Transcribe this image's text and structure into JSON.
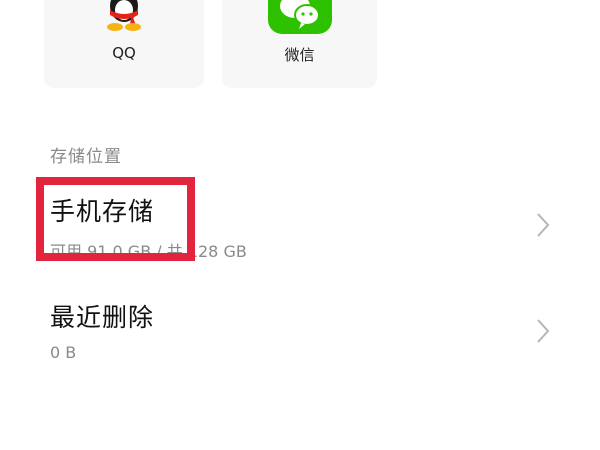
{
  "apps": [
    {
      "label": "QQ",
      "icon": "qq-penguin-icon",
      "color": "#e62117"
    },
    {
      "label": "微信",
      "icon": "wechat-icon",
      "color": "#2dc100"
    }
  ],
  "storage_section": {
    "header": "存储位置",
    "items": [
      {
        "title": "手机存储",
        "subtitle": "可用 91.0 GB / 共 128 GB"
      },
      {
        "title": "最近删除",
        "subtitle": "0 B"
      }
    ]
  },
  "annotation": {
    "color": "#e2243f"
  }
}
